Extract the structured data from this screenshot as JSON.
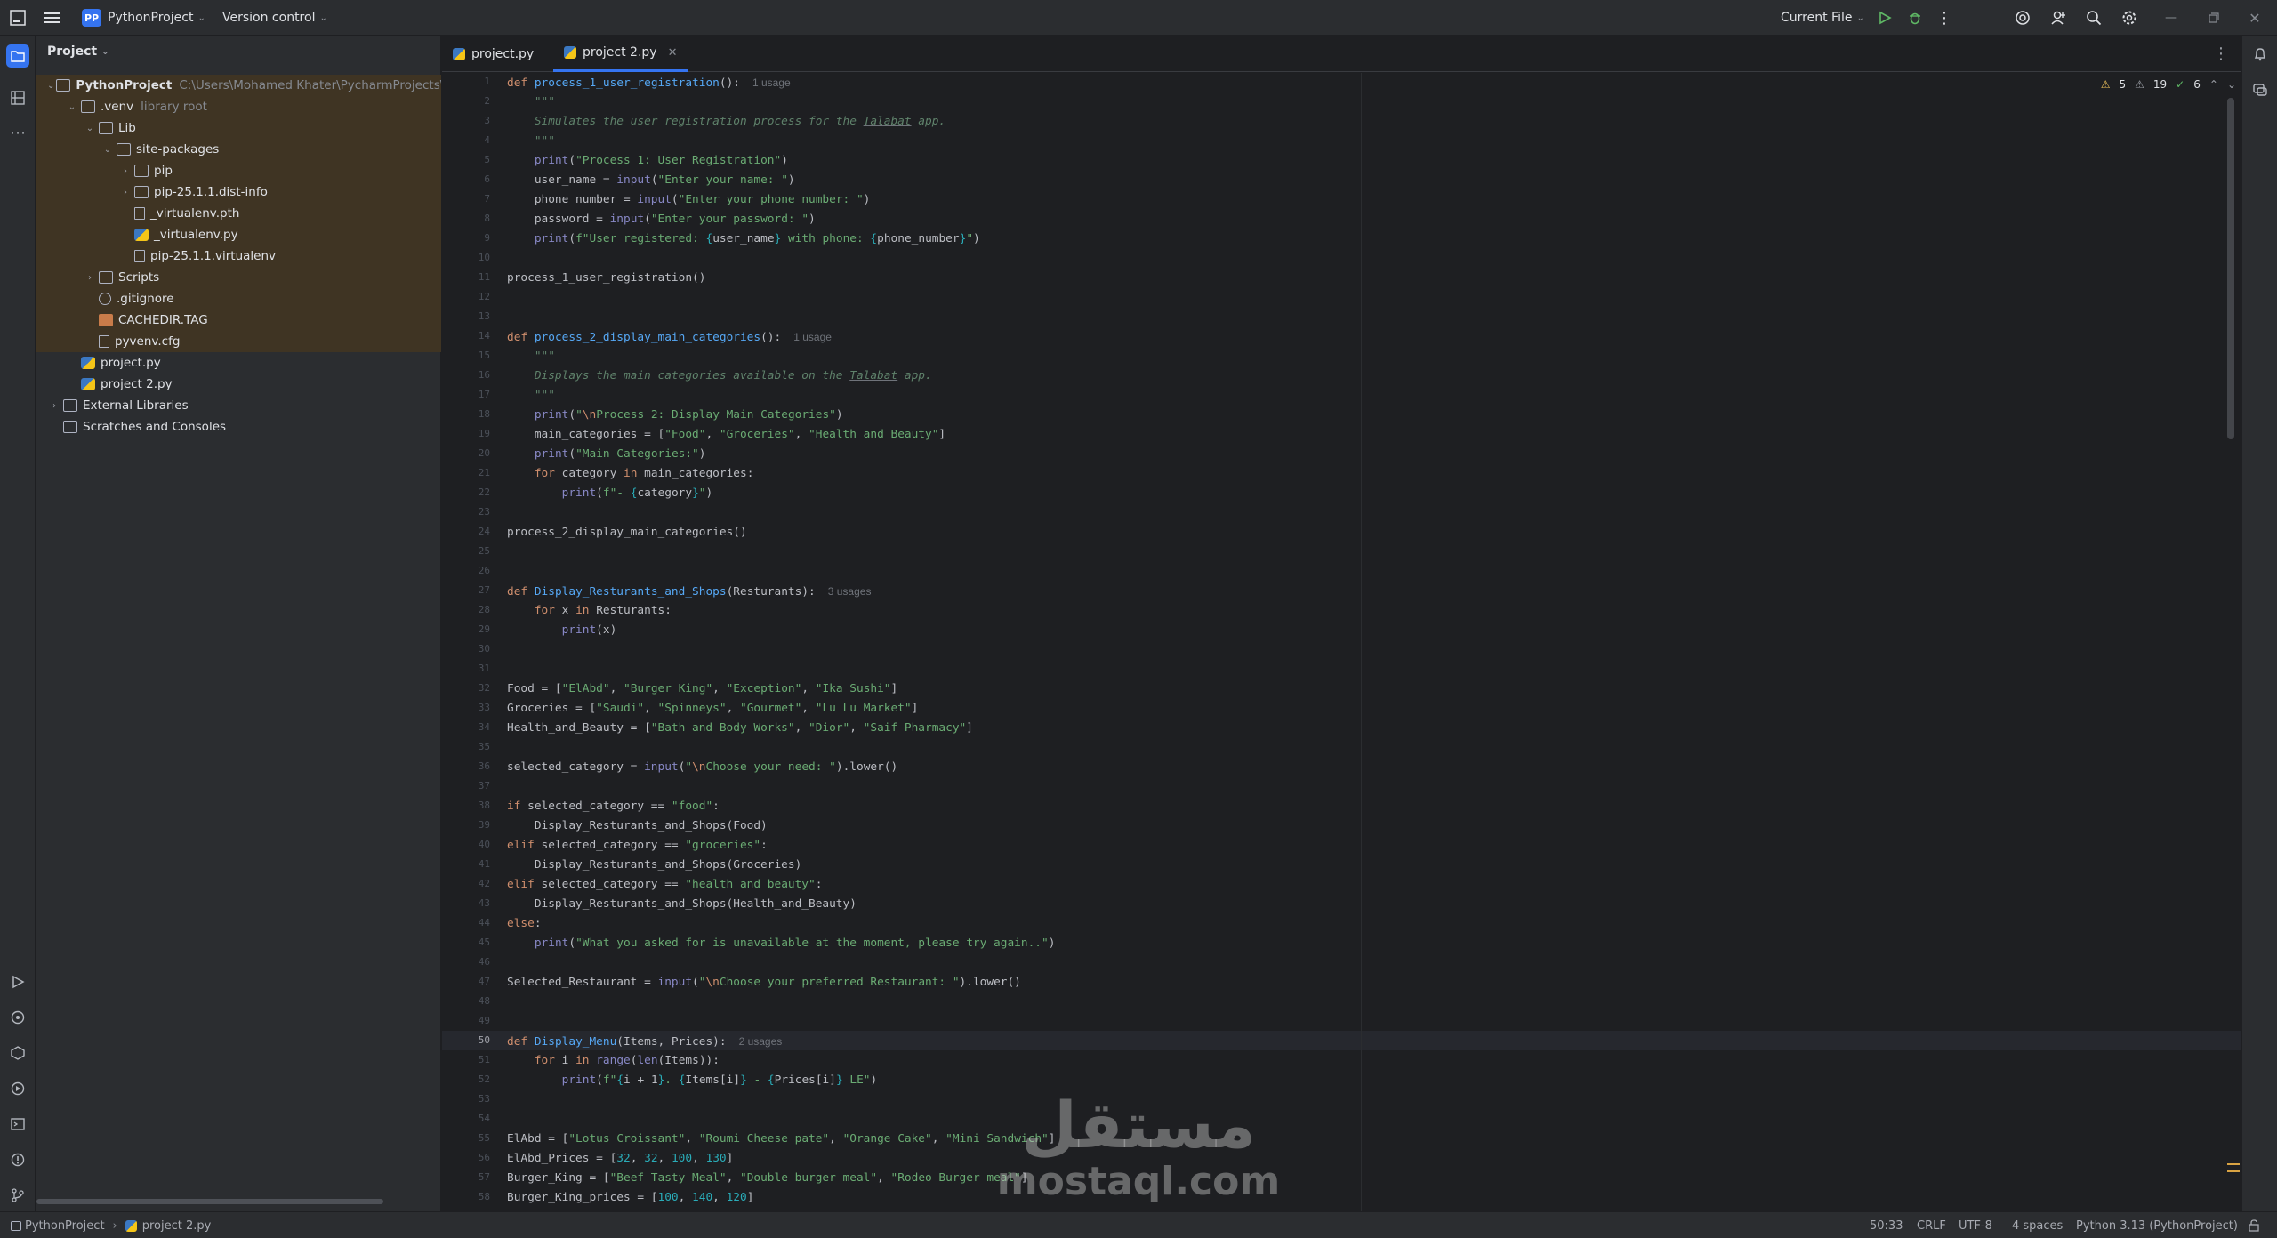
{
  "titlebar": {
    "project_badge": "PP",
    "project_name": "PythonProject",
    "vcs": "Version control",
    "run_config": "Current File"
  },
  "project_panel": {
    "title": "Project",
    "tree": [
      {
        "label": "PythonProject",
        "dim": "C:\\Users\\Mohamed Khater\\PycharmProjects\\Pyth"
      },
      {
        "label": ".venv",
        "dim": "library root"
      },
      {
        "label": "Lib",
        "dim": ""
      },
      {
        "label": "site-packages",
        "dim": ""
      },
      {
        "label": "pip",
        "dim": ""
      },
      {
        "label": "pip-25.1.1.dist-info",
        "dim": ""
      },
      {
        "label": "_virtualenv.pth",
        "dim": ""
      },
      {
        "label": "_virtualenv.py",
        "dim": ""
      },
      {
        "label": "pip-25.1.1.virtualenv",
        "dim": ""
      },
      {
        "label": "Scripts",
        "dim": ""
      },
      {
        "label": ".gitignore",
        "dim": ""
      },
      {
        "label": "CACHEDIR.TAG",
        "dim": ""
      },
      {
        "label": "pyvenv.cfg",
        "dim": ""
      },
      {
        "label": "project.py",
        "dim": ""
      },
      {
        "label": "project 2.py",
        "dim": ""
      },
      {
        "label": "External Libraries",
        "dim": ""
      },
      {
        "label": "Scratches and Consoles",
        "dim": ""
      }
    ]
  },
  "tabs": [
    {
      "label": "project.py"
    },
    {
      "label": "project 2.py"
    }
  ],
  "inspections": {
    "warnings": "5",
    "weak": "19",
    "ok": "6"
  },
  "editor": {
    "current_line": "50",
    "lines": [
      "def process_1_user_registration():",
      "    \"\"\"",
      "    Simulates the user registration process for the Talabat app.",
      "    \"\"\"",
      "    print(\"Process 1: User Registration\")",
      "    user_name = input(\"Enter your name: \")",
      "    phone_number = input(\"Enter your phone number: \")",
      "    password = input(\"Enter your password: \")",
      "    print(f\"User registered: {user_name} with phone: {phone_number}\")",
      "",
      "process_1_user_registration()",
      "",
      "",
      "def process_2_display_main_categories():",
      "    \"\"\"",
      "    Displays the main categories available on the Talabat app.",
      "    \"\"\"",
      "    print(\"\\nProcess 2: Display Main Categories\")",
      "    main_categories = [\"Food\", \"Groceries\", \"Health and Beauty\"]",
      "    print(\"Main Categories:\")",
      "    for category in main_categories:",
      "        print(f\"- {category}\")",
      "",
      "process_2_display_main_categories()",
      "",
      "",
      "def Display_Resturants_and_Shops(Resturants):",
      "    for x in Resturants:",
      "        print(x)",
      "",
      "",
      "Food = [\"ElAbd\", \"Burger King\", \"Exception\", \"Ika Sushi\"]",
      "Groceries = [\"Saudi\", \"Spinneys\", \"Gourmet\", \"Lu Lu Market\"]",
      "Health_and_Beauty = [\"Bath and Body Works\", \"Dior\", \"Saif Pharmacy\"]",
      "",
      "selected_category = input(\"\\nChoose your need: \").lower()",
      "",
      "if selected_category == \"food\":",
      "    Display_Resturants_and_Shops(Food)",
      "elif selected_category == \"groceries\":",
      "    Display_Resturants_and_Shops(Groceries)",
      "elif selected_category == \"health and beauty\":",
      "    Display_Resturants_and_Shops(Health_and_Beauty)",
      "else:",
      "    print(\"What you asked for is unavailable at the moment, please try again..\")",
      "",
      "Selected_Restaurant = input(\"\\nChoose your preferred Restaurant: \").lower()",
      "",
      "",
      "def Display_Menu(Items, Prices):",
      "    for i in range(len(Items)):",
      "        print(f\"{i + 1}. {Items[i]} - {Prices[i]} LE\")",
      "",
      "",
      "ElAbd = [\"Lotus Croissant\", \"Roumi Cheese pate\", \"Orange Cake\", \"Mini Sandwich\"]",
      "ElAbd_Prices = [32, 32, 100, 130]",
      "Burger_King = [\"Beef Tasty Meal\", \"Double burger meal\", \"Rodeo Burger meal\"]",
      "Burger_King_prices = [100, 140, 120]"
    ],
    "usage_hints": {
      "1": "1 usage",
      "14": "1 usage",
      "27": "3 usages",
      "50": "2 usages"
    }
  },
  "statusbar": {
    "breadcrumb_project": "PythonProject",
    "breadcrumb_file": "project 2.py",
    "position": "50:33",
    "line_sep": "CRLF",
    "encoding": "UTF-8",
    "indent": "4 spaces",
    "interpreter": "Python 3.13 (PythonProject)"
  },
  "watermark": {
    "arabic": "مستقل",
    "latin": "mostaql.com"
  }
}
